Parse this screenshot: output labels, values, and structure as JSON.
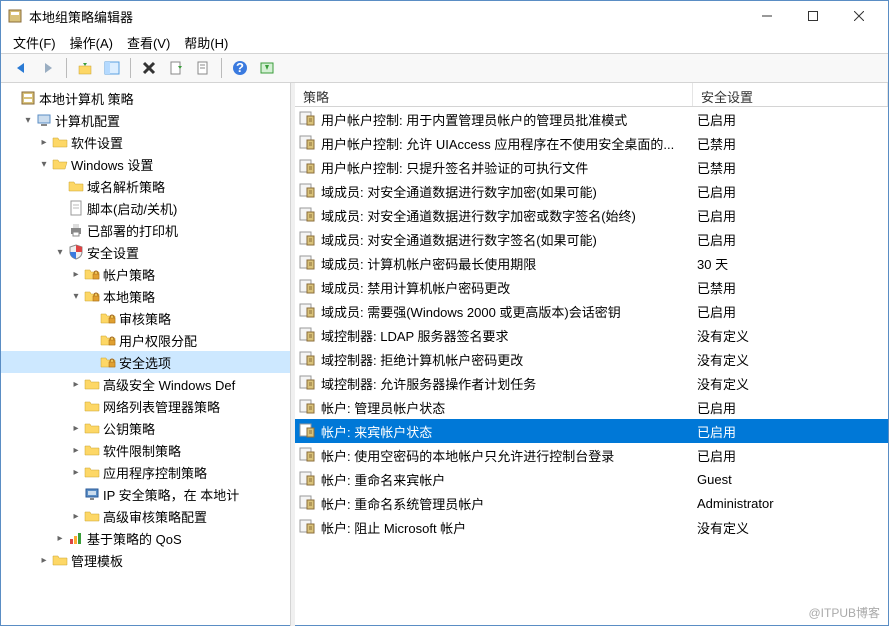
{
  "window": {
    "title": "本地组策略编辑器"
  },
  "menu": {
    "file": "文件(F)",
    "action": "操作(A)",
    "view": "查看(V)",
    "help": "帮助(H)"
  },
  "tree": {
    "root": {
      "label": "本地计算机 策略"
    },
    "computer_config": {
      "label": "计算机配置"
    },
    "software": {
      "label": "软件设置"
    },
    "windows_settings": {
      "label": "Windows 设置"
    },
    "name_res": {
      "label": "域名解析策略"
    },
    "scripts": {
      "label": "脚本(启动/关机)"
    },
    "printers": {
      "label": "已部署的打印机"
    },
    "security": {
      "label": "安全设置"
    },
    "account_pol": {
      "label": "帐户策略"
    },
    "local_pol": {
      "label": "本地策略"
    },
    "audit": {
      "label": "审核策略"
    },
    "user_rights": {
      "label": "用户权限分配"
    },
    "sec_options": {
      "label": "安全选项"
    },
    "adv_firewall": {
      "label": "高级安全 Windows Def"
    },
    "net_list": {
      "label": "网络列表管理器策略"
    },
    "pubkey": {
      "label": "公钥策略"
    },
    "soft_restrict": {
      "label": "软件限制策略"
    },
    "app_ctrl": {
      "label": "应用程序控制策略"
    },
    "ipsec": {
      "label": "IP 安全策略，在 本地计"
    },
    "adv_audit": {
      "label": "高级审核策略配置"
    },
    "qos": {
      "label": "基于策略的 QoS"
    },
    "admin_tmpl": {
      "label": "管理模板"
    }
  },
  "list": {
    "headers": {
      "policy": "策略",
      "setting": "安全设置"
    },
    "rows": [
      {
        "name": "用户帐户控制: 用于内置管理员帐户的管理员批准模式",
        "value": "已启用",
        "selected": false
      },
      {
        "name": "用户帐户控制: 允许 UIAccess 应用程序在不使用安全桌面的...",
        "value": "已禁用",
        "selected": false
      },
      {
        "name": "用户帐户控制: 只提升签名并验证的可执行文件",
        "value": "已禁用",
        "selected": false
      },
      {
        "name": "域成员: 对安全通道数据进行数字加密(如果可能)",
        "value": "已启用",
        "selected": false
      },
      {
        "name": "域成员: 对安全通道数据进行数字加密或数字签名(始终)",
        "value": "已启用",
        "selected": false
      },
      {
        "name": "域成员: 对安全通道数据进行数字签名(如果可能)",
        "value": "已启用",
        "selected": false
      },
      {
        "name": "域成员: 计算机帐户密码最长使用期限",
        "value": "30 天",
        "selected": false
      },
      {
        "name": "域成员: 禁用计算机帐户密码更改",
        "value": "已禁用",
        "selected": false
      },
      {
        "name": "域成员: 需要强(Windows 2000 或更高版本)会话密钥",
        "value": "已启用",
        "selected": false
      },
      {
        "name": "域控制器: LDAP 服务器签名要求",
        "value": "没有定义",
        "selected": false
      },
      {
        "name": "域控制器: 拒绝计算机帐户密码更改",
        "value": "没有定义",
        "selected": false
      },
      {
        "name": "域控制器: 允许服务器操作者计划任务",
        "value": "没有定义",
        "selected": false
      },
      {
        "name": "帐户: 管理员帐户状态",
        "value": "已启用",
        "selected": false
      },
      {
        "name": "帐户: 来宾帐户状态",
        "value": "已启用",
        "selected": true
      },
      {
        "name": "帐户: 使用空密码的本地帐户只允许进行控制台登录",
        "value": "已启用",
        "selected": false
      },
      {
        "name": "帐户: 重命名来宾帐户",
        "value": "Guest",
        "selected": false
      },
      {
        "name": "帐户: 重命名系统管理员帐户",
        "value": "Administrator",
        "selected": false
      },
      {
        "name": "帐户: 阻止 Microsoft 帐户",
        "value": "没有定义",
        "selected": false
      }
    ]
  },
  "watermark": "@ITPUB博客"
}
